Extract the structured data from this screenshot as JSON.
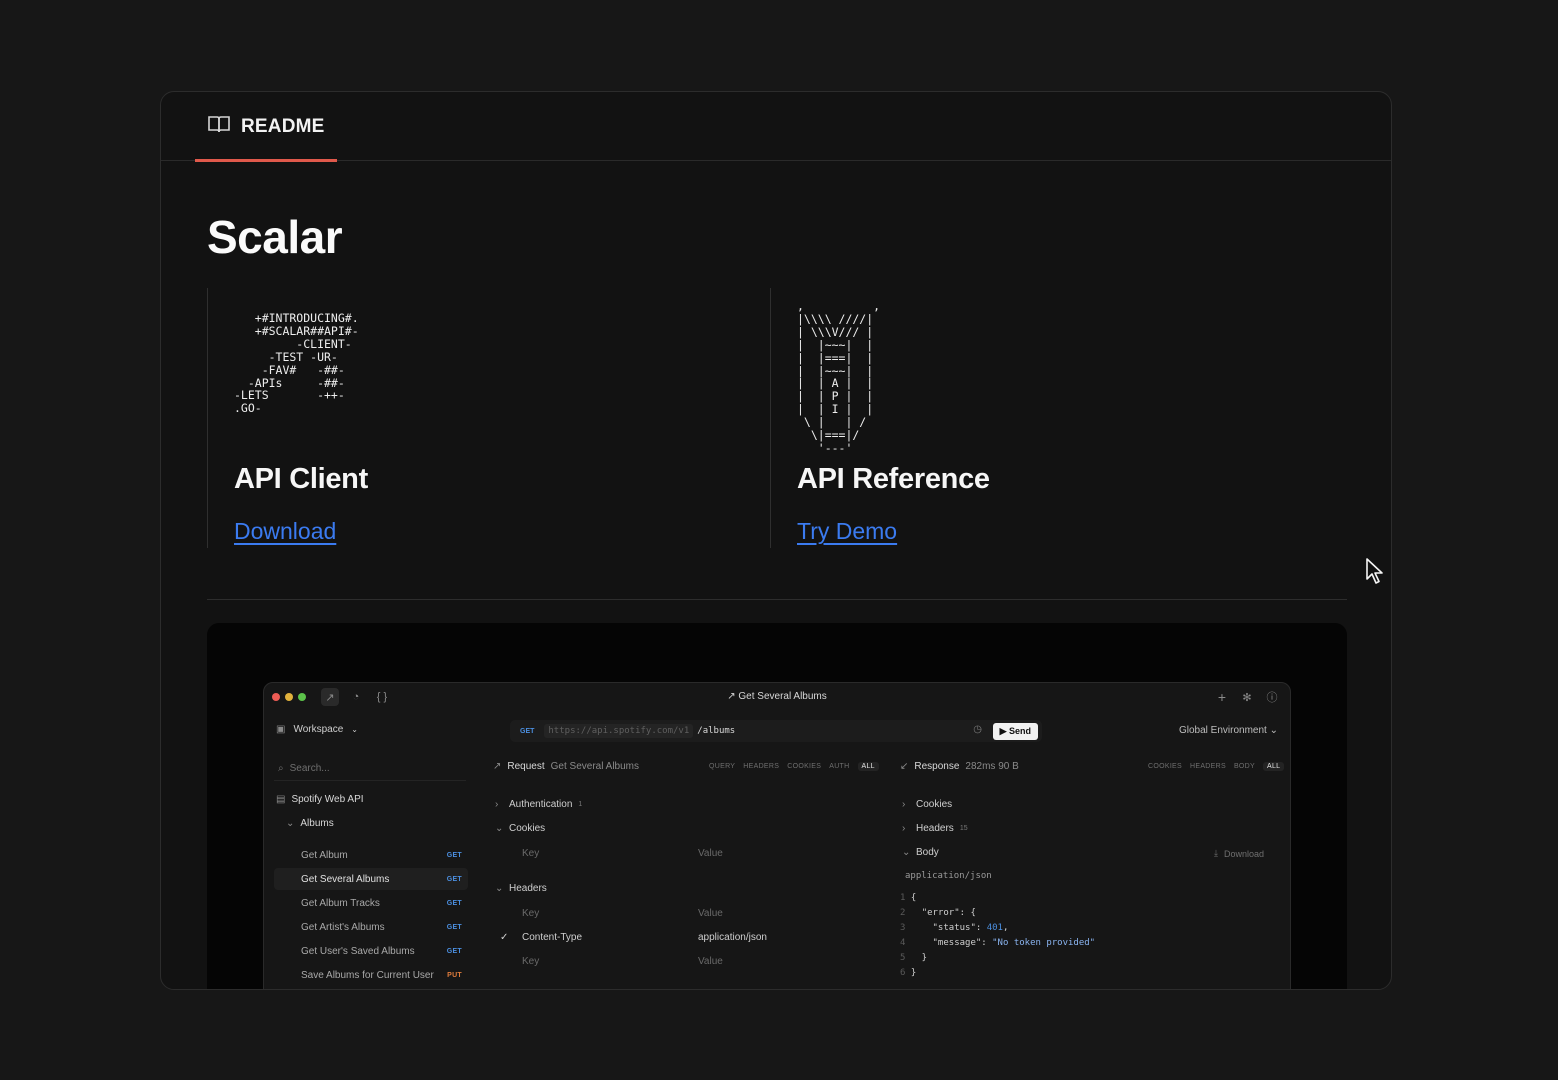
{
  "tab": {
    "label": "README",
    "icon": "book-open-icon"
  },
  "page_title": "Scalar",
  "columns": [
    {
      "ascii": "   +#INTRODUCING#.\n   +#SCALAR##API#-\n         -CLIENT-\n     -TEST -UR-\n    -FAV#   -##-\n  -APIs     -##-\n-LETS       -++-\n.GO-",
      "title": "API Client",
      "link": "Download"
    },
    {
      "ascii": ",          ,\n|\\\\\\\\ ////|\n| \\\\\\V/// |\n|  |~~~|  |\n|  |===|  |\n|  |~~~|  |\n|  | A |  |\n|  | P |  |\n|  | I |  |\n \\ |   | /\n  \\|===|/\n   '---'",
      "title": "API Reference",
      "link": "Try Demo"
    }
  ],
  "app": {
    "window_title": "Get Several Albums",
    "workspace": "Workspace",
    "search_placeholder": "Search...",
    "collection": "Spotify Web API",
    "folder": "Albums",
    "endpoints": [
      {
        "label": "Get Album",
        "method": "GET"
      },
      {
        "label": "Get Several Albums",
        "method": "GET",
        "active": true
      },
      {
        "label": "Get Album Tracks",
        "method": "GET"
      },
      {
        "label": "Get Artist's Albums",
        "method": "GET"
      },
      {
        "label": "Get User's Saved Albums",
        "method": "GET"
      },
      {
        "label": "Save Albums for Current User",
        "method": "PUT"
      }
    ],
    "url": {
      "method": "GET",
      "base": "https://api.spotify.com/v1",
      "path": "/albums",
      "send": "Send"
    },
    "environment": "Global Environment",
    "request": {
      "label": "Request",
      "name": "Get Several Albums",
      "filters": [
        "QUERY",
        "HEADERS",
        "COOKIES",
        "AUTH",
        "ALL"
      ],
      "authentication": "Authentication",
      "auth_count": "1",
      "cookies": "Cookies",
      "headers": "Headers",
      "key": "Key",
      "value": "Value",
      "header_name": "Content-Type",
      "header_value": "application/json"
    },
    "response": {
      "label": "Response",
      "meta": "282ms 90 B",
      "filters": [
        "COOKIES",
        "HEADERS",
        "BODY",
        "ALL"
      ],
      "cookies": "Cookies",
      "headers": "Headers",
      "headers_count": "15",
      "body": "Body",
      "download": "Download",
      "content_type": "application/json",
      "code_lines": [
        "1",
        "2",
        "3",
        "4",
        "5",
        "6"
      ],
      "key_error": "\"error\"",
      "key_status": "\"status\"",
      "status_value": "401",
      "key_message": "\"message\"",
      "message_value": "\"No token provided\""
    }
  },
  "colors": {
    "accent": "#e0594b",
    "link": "#3b7bf0",
    "get": "#4b8fe0",
    "put": "#e07c3c"
  }
}
